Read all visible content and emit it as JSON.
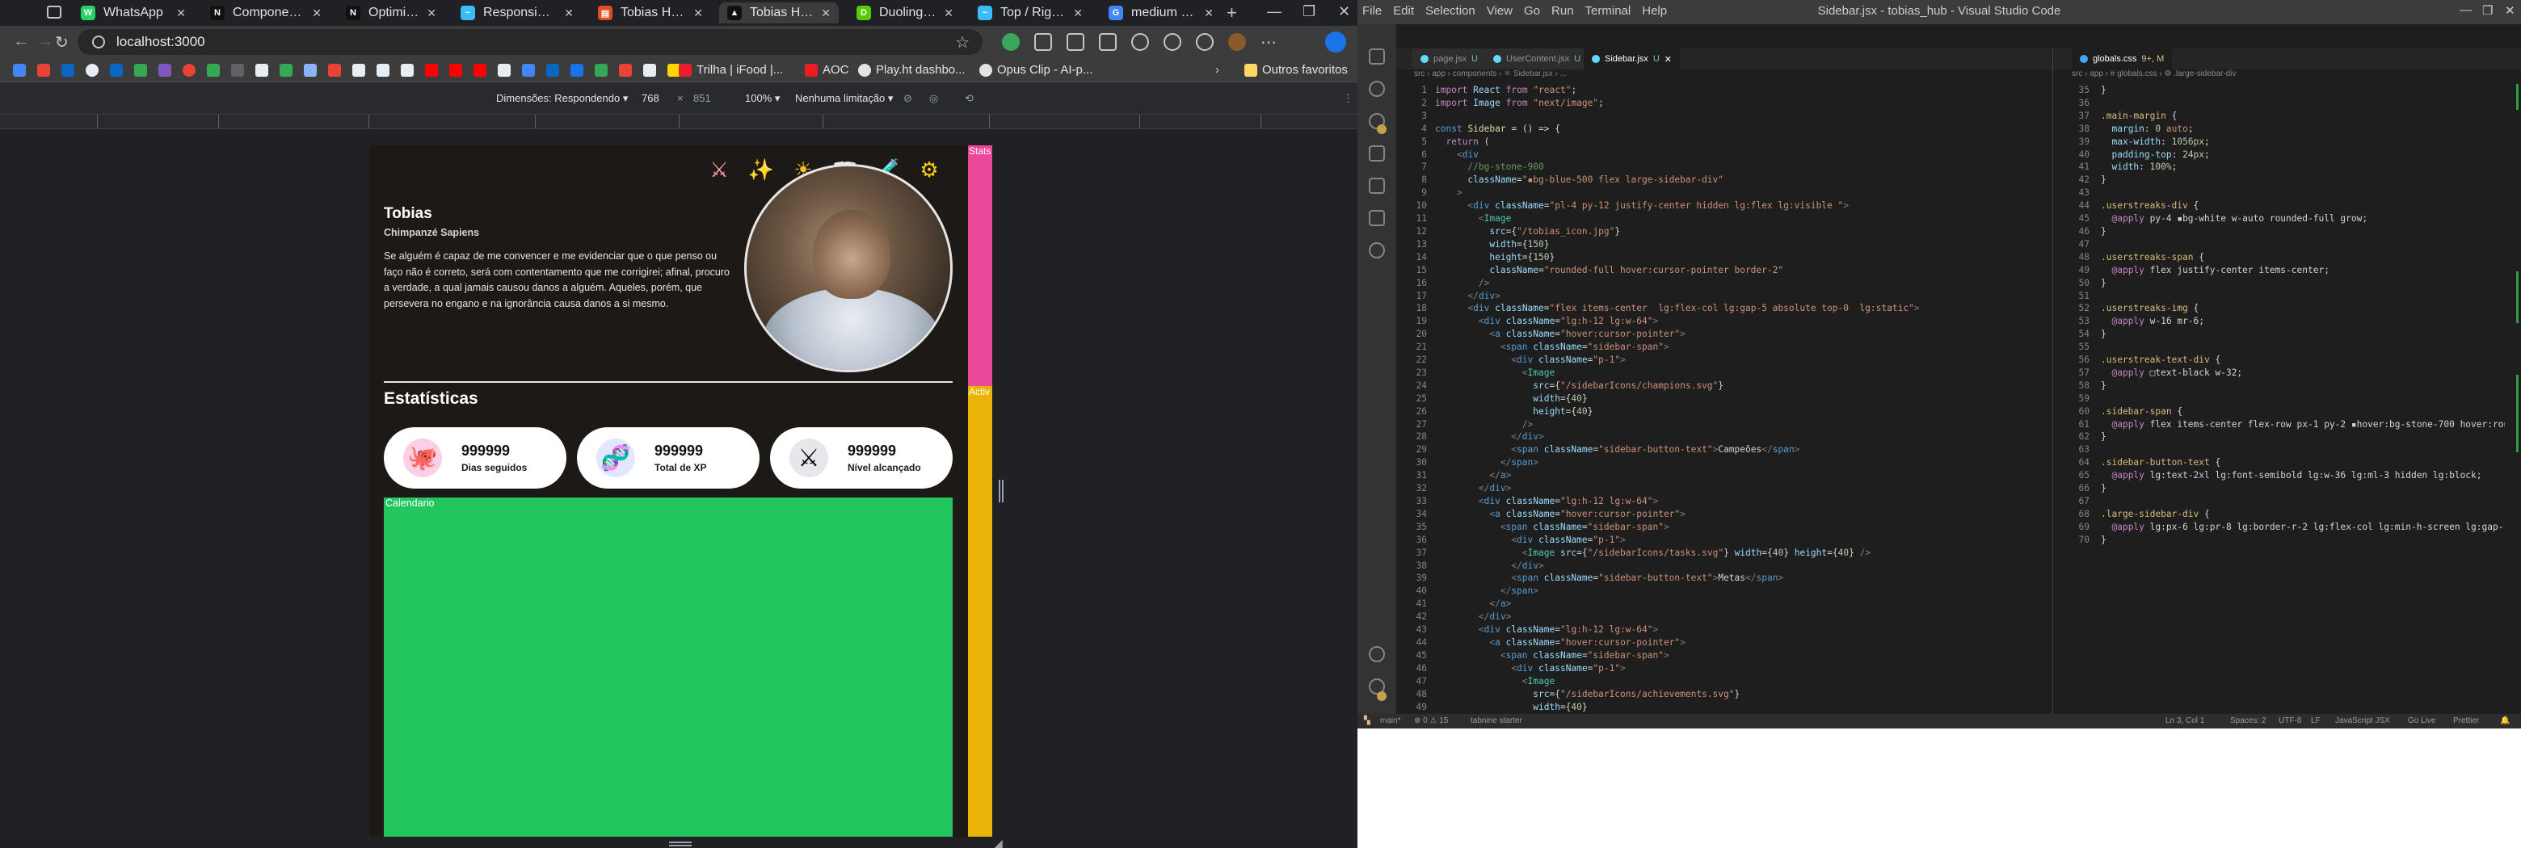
{
  "browser": {
    "tabs": [
      {
        "title": "WhatsApp",
        "color": "#25d366",
        "glyph": "W"
      },
      {
        "title": "Components",
        "color": "#111111",
        "glyph": "N"
      },
      {
        "title": "Optimizing: Im",
        "color": "#111111",
        "glyph": "N"
      },
      {
        "title": "Responsive De",
        "color": "#38bdf8",
        "glyph": "~"
      },
      {
        "title": "Tobias HUB",
        "color": "#e34c26",
        "glyph": "▤"
      },
      {
        "title": "Tobias Hub",
        "color": "#111111",
        "glyph": "▲"
      },
      {
        "title": "Duolingo - A m",
        "color": "#58cc02",
        "glyph": "D"
      },
      {
        "title": "Top / Right / B",
        "color": "#38bdf8",
        "glyph": "~"
      },
      {
        "title": "medium width",
        "color": "#4285f4",
        "glyph": "G"
      }
    ],
    "url": "localhost:3000",
    "bookmarks": [
      "Trilha | iFood |...",
      "AOC",
      "Play.ht dashbo...",
      "Opus Clip - AI-p...",
      "Outros favoritos"
    ],
    "devtools": {
      "dimensions_label": "Dimensões: Respondendo",
      "width": "768",
      "times": "×",
      "height": "851",
      "zoom": "100%",
      "throttle": "Nenhuma limitação"
    }
  },
  "site": {
    "name": "Tobias",
    "subtitle": "Chimpanzé Sapiens",
    "bio": "Se alguém é capaz de me convencer e me evidenciar que o que penso ou faço não é correto, será com contentamento que me corrigirei; afinal, procuro a verdade, a qual jamais causou danos a alguém. Aqueles, porém, que persevera no engano e na ignorância causa danos a si mesmo.",
    "achievements": [
      "⚔",
      "✨",
      "☀",
      "📖",
      "🧪",
      "⚙"
    ],
    "stats_title": "Estatísticas",
    "stats": [
      {
        "value": "999999",
        "label": "Dias seguidos",
        "glyph": "🐙",
        "color": "#fbcfe8"
      },
      {
        "value": "999999",
        "label": "Total de XP",
        "glyph": "🧬",
        "color": "#e0e7ff"
      },
      {
        "value": "999999",
        "label": "Nível alcançado",
        "glyph": "⚔",
        "color": "#e5e7eb"
      }
    ],
    "calendar_label": "Calendario",
    "side_stats": "Stats",
    "side_activ": "Activ"
  },
  "vscode": {
    "title": "Sidebar.jsx - tobias_hub - Visual Studio Code",
    "menu": [
      "File",
      "Edit",
      "Selection",
      "View",
      "Go",
      "Run",
      "Terminal",
      "Help"
    ],
    "tabs": [
      {
        "label": "page.jsx",
        "flag": "U",
        "color": "#61dafb"
      },
      {
        "label": "UserContent.jsx",
        "flag": "U",
        "color": "#61dafb"
      },
      {
        "label": "Sidebar.jsx",
        "flag": "U",
        "color": "#61dafb"
      },
      {
        "label": "globals.css",
        "flag": "9+, M",
        "color": "#42a5f5"
      }
    ],
    "left_breadcrumb": "src › app › components › ⚛ Sidebar.jsx › ...",
    "right_breadcrumb": "src › app › # globals.css › ⚙ .large-sidebar-div",
    "status": {
      "branch": "main*",
      "errors": "⊗ 0 ⚠ 15",
      "tabnine": "tabnine starter",
      "position": "Ln 3, Col 1",
      "spaces": "Spaces: 2",
      "encoding": "UTF-8",
      "eol": "LF",
      "lang": "JavaScript JSX",
      "golive": "Go Live",
      "prettier": "Prettier"
    }
  }
}
